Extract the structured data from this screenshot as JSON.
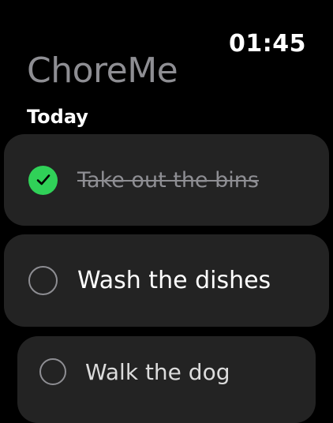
{
  "status": {
    "time": "01:45"
  },
  "app": {
    "title": "ChoreMe"
  },
  "section": {
    "title": "Today"
  },
  "chores": [
    {
      "label": "Take out the bins",
      "done": true
    },
    {
      "label": "Wash the dishes",
      "done": false
    },
    {
      "label": "Walk the dog",
      "done": false
    }
  ],
  "colors": {
    "background": "#000000",
    "row": "#232323",
    "accent_done": "#30d158",
    "muted": "#8e8e93"
  },
  "icons": {
    "done": "checkmark-circle-icon",
    "open": "empty-circle-icon"
  }
}
